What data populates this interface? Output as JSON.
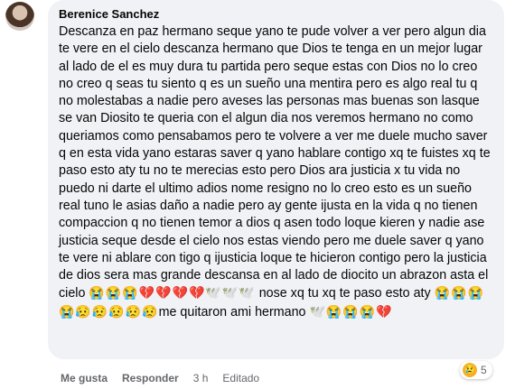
{
  "comment": {
    "author": "Berenice Sanchez",
    "text": "Descanza en paz hermano seque yano te pude volver a ver pero algun dia te vere en el cielo descanza hermano que Dios te tenga en un mejor lugar al lado de el es muy dura tu partida pero seque estas con Dios no lo creo no creo q seas tu siento q es un sueño una mentira pero es algo real tu q no molestabas a nadie pero aveses las personas mas buenas son lasque se van Diosito te queria con el algun dia nos veremos hermano no como queriamos como pensabamos pero te volvere a ver me duele mucho saver q en esta vida yano estaras saver q yano hablare contigo xq te fuistes xq te paso esto aty tu no te merecias esto pero Dios ara justicia x tu vida no puedo ni darte el ultimo adios nome resigno no lo creo esto es un sueño real tuno le asias daño a nadie pero ay gente ijusta en la vida q no tienen compaccion q no tienen temor a dios q asen todo loque kieren y nadie ase justicia seque desde el cielo nos estas viendo pero me duele saver q yano te vere ni ablare con tigo q ijusticia loque te hicieron contigo pero la justicia de dios sera mas grande descansa en al lado de diocito un abrazon asta el cielo",
    "emoji_run_1": "😭😭😭💔💔💔💔🕊️🕊️🕊️",
    "text_2": " nose xq tu xq te paso esto aty ",
    "emoji_run_2": "😭😭😭😭😥😥😥😥😥",
    "text_3": "me quitaron ami hermano ",
    "emoji_run_3": "🕊️😭😭😭💔"
  },
  "actions": {
    "like": "Me gusta",
    "reply": "Responder",
    "time": "3 h",
    "edited": "Editado"
  },
  "reaction": {
    "icon": "😢",
    "count": "5"
  }
}
